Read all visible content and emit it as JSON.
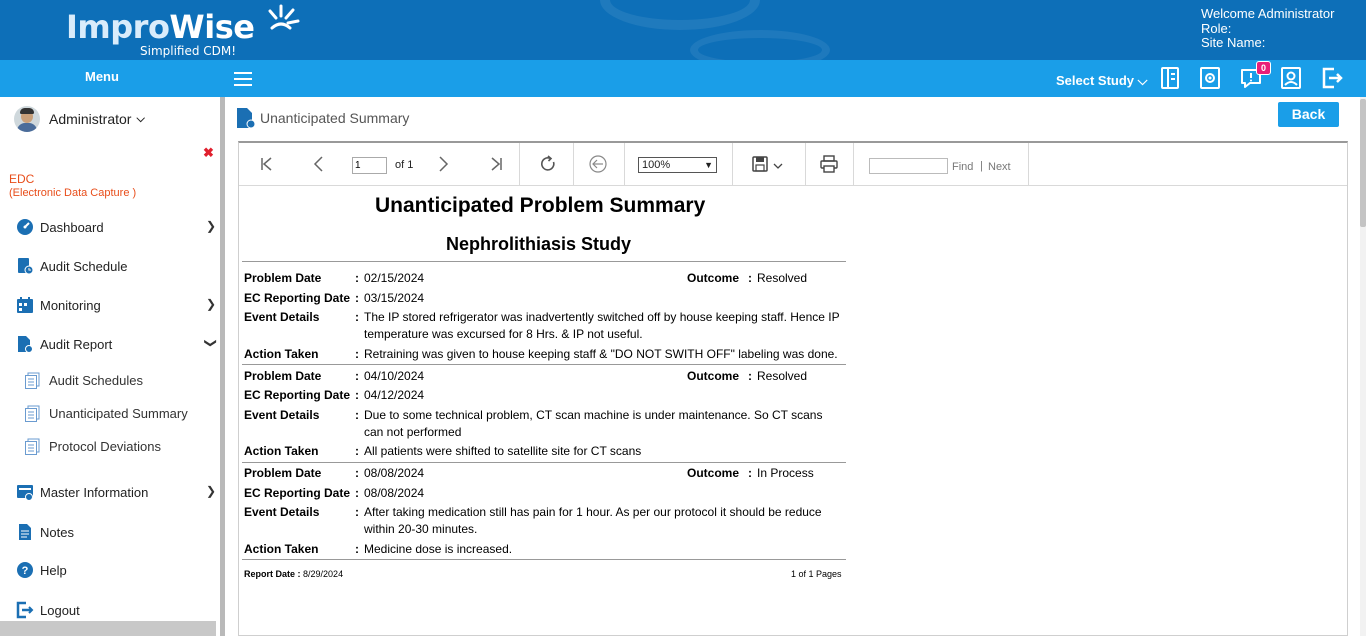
{
  "header": {
    "brand_prefix": "Impro",
    "brand_suffix": "Wise",
    "tagline": "Simplified CDM!",
    "welcome": "Welcome  Administrator",
    "role": "Role:",
    "site_name": "Site Name:",
    "menu_label": "Menu",
    "select_study": "Select Study",
    "notification_count": "0"
  },
  "sidebar": {
    "user": "Administrator",
    "module_title": "EDC",
    "module_subtitle": "(Electronic Data Capture )",
    "items": [
      {
        "label": "Dashboard"
      },
      {
        "label": "Audit Schedule"
      },
      {
        "label": "Monitoring"
      },
      {
        "label": "Audit Report"
      },
      {
        "label": "Master Information"
      },
      {
        "label": "Notes"
      },
      {
        "label": "Help"
      },
      {
        "label": "Logout"
      }
    ],
    "sub_items": [
      {
        "label": "Audit Schedules"
      },
      {
        "label": "Unanticipated Summary"
      },
      {
        "label": "Protocol Deviations"
      }
    ]
  },
  "content": {
    "page_title": "Unanticipated Summary",
    "back_label": "Back"
  },
  "viewer": {
    "page_value": "1",
    "page_of": "of 1",
    "zoom": "100%",
    "find_label": "Find",
    "next_label": "Next"
  },
  "report": {
    "title": "Unanticipated Problem Summary",
    "subtitle": "Nephrolithiasis Study",
    "labels": {
      "problem_date": "Problem Date",
      "ec_date": "EC Reporting Date",
      "event": "Event Details",
      "action": "Action Taken",
      "outcome": "Outcome"
    },
    "entries": [
      {
        "problem_date": "02/15/2024",
        "outcome": "Resolved",
        "ec_date": "03/15/2024",
        "event": "The IP stored refrigerator was inadvertently switched off by house keeping staff. Hence IP temperature was excursed for 8 Hrs. & IP not useful.",
        "action": "Retraining was given to house keeping staff & \"DO NOT SWITH OFF\" labeling was done."
      },
      {
        "problem_date": "04/10/2024",
        "outcome": "Resolved",
        "ec_date": "04/12/2024",
        "event": "Due to some technical problem, CT scan machine is under maintenance. So CT scans can not performed",
        "action": "All patients were shifted to satellite site for CT scans"
      },
      {
        "problem_date": "08/08/2024",
        "outcome": "In Process",
        "ec_date": "08/08/2024",
        "event": "After taking medication still has pain for 1 hour. As per our protocol it should be reduce within 20-30 minutes.",
        "action": "Medicine dose is increased."
      }
    ],
    "report_date_label": "Report Date :",
    "report_date": "8/29/2024",
    "pages": "1 of 1 Pages"
  }
}
